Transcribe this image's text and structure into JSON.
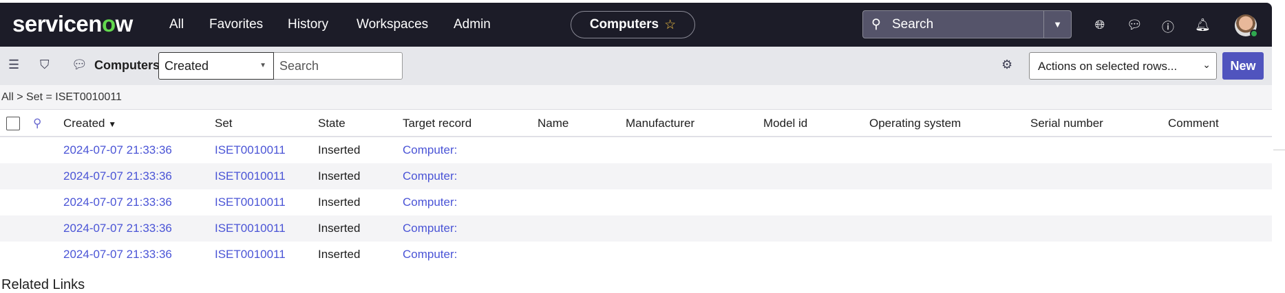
{
  "nav": {
    "logo": "servicenow",
    "links": [
      "All",
      "Favorites",
      "History",
      "Workspaces",
      "Admin"
    ],
    "context_pill": "Computers",
    "search_placeholder": "Search"
  },
  "toolbar": {
    "title": "Computers",
    "field_select": "Created",
    "search_placeholder": "Search",
    "actions_select": "Actions on selected rows...",
    "new_label": "New"
  },
  "breadcrumb": "All > Set = ISET0010011",
  "table": {
    "columns": [
      "Created",
      "Set",
      "State",
      "Target record",
      "Name",
      "Manufacturer",
      "Model id",
      "Operating system",
      "Serial number",
      "Comment"
    ],
    "rows": [
      [
        "2024-07-07 21:33:36",
        "ISET0010011",
        "Inserted",
        "Computer:"
      ],
      [
        "2024-07-07 21:33:36",
        "ISET0010011",
        "Inserted",
        "Computer:"
      ],
      [
        "2024-07-07 21:33:36",
        "ISET0010011",
        "Inserted",
        "Computer:"
      ],
      [
        "2024-07-07 21:33:36",
        "ISET0010011",
        "Inserted",
        "Computer:"
      ],
      [
        "2024-07-07 21:33:36",
        "ISET0010011",
        "Inserted",
        "Computer:"
      ]
    ]
  },
  "related_links": "Related Links",
  "colors": {
    "nav_bg": "#1c1c28",
    "accent": "#5054be",
    "link": "#4a54d6",
    "logo_green": "#62d84e"
  }
}
